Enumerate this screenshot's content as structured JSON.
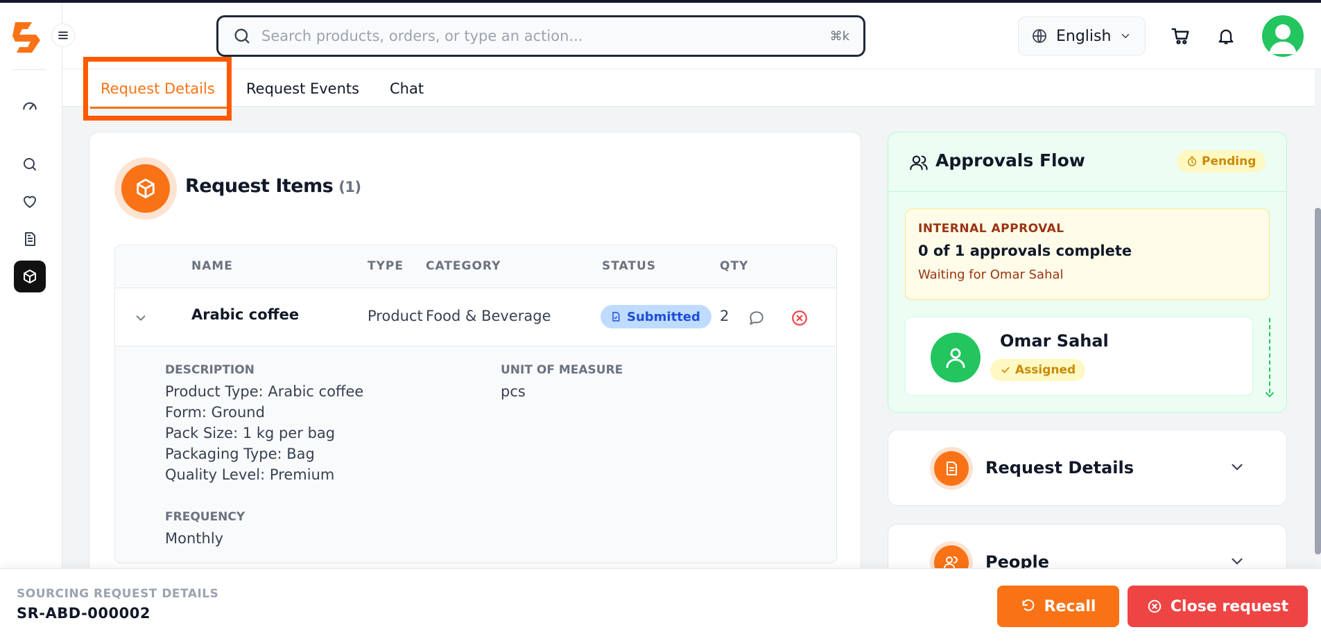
{
  "header": {
    "search_placeholder": "Search products, orders, or type an action...",
    "search_shortcut": "⌘k",
    "language": "English"
  },
  "sidebar": {
    "items": [
      {
        "icon": "dashboard-icon"
      },
      {
        "icon": "search-icon"
      },
      {
        "icon": "heart-icon"
      },
      {
        "icon": "document-icon"
      },
      {
        "icon": "package-icon",
        "active": true
      }
    ]
  },
  "tabs": [
    {
      "label": "Request Details",
      "active": true
    },
    {
      "label": "Request Events"
    },
    {
      "label": "Chat"
    }
  ],
  "request_items": {
    "title": "Request Items",
    "count": "(1)",
    "columns": [
      "NAME",
      "TYPE",
      "CATEGORY",
      "STATUS",
      "QTY"
    ],
    "rows": [
      {
        "name": "Arabic coffee",
        "type": "Product",
        "category": "Food & Beverage",
        "status": "Submitted",
        "qty": "2"
      }
    ],
    "detail": {
      "description_label": "DESCRIPTION",
      "description_lines": [
        "Product Type: Arabic coffee",
        "Form: Ground",
        "Pack Size: 1 kg per bag",
        "Packaging Type: Bag",
        "Quality Level: Premium"
      ],
      "uom_label": "UNIT OF MEASURE",
      "uom_value": "pcs",
      "frequency_label": "FREQUENCY",
      "frequency_value": "Monthly"
    }
  },
  "approvals": {
    "title": "Approvals Flow",
    "status": "Pending",
    "internal_label": "INTERNAL APPROVAL",
    "progress_text": "0 of 1 approvals complete",
    "waiting_text": "Waiting for Omar Sahal",
    "approver_name": "Omar Sahal",
    "approver_status": "Assigned"
  },
  "side_sections": [
    {
      "title": "Request Details"
    },
    {
      "title": "People"
    }
  ],
  "footer": {
    "label": "SOURCING REQUEST DETAILS",
    "request_id": "SR-ABD-000002",
    "recall_label": "Recall",
    "close_label": "Close request"
  },
  "colors": {
    "accent": "#f97316",
    "danger": "#ef4444",
    "success": "#22c55e",
    "info": "#1d4ed8"
  }
}
